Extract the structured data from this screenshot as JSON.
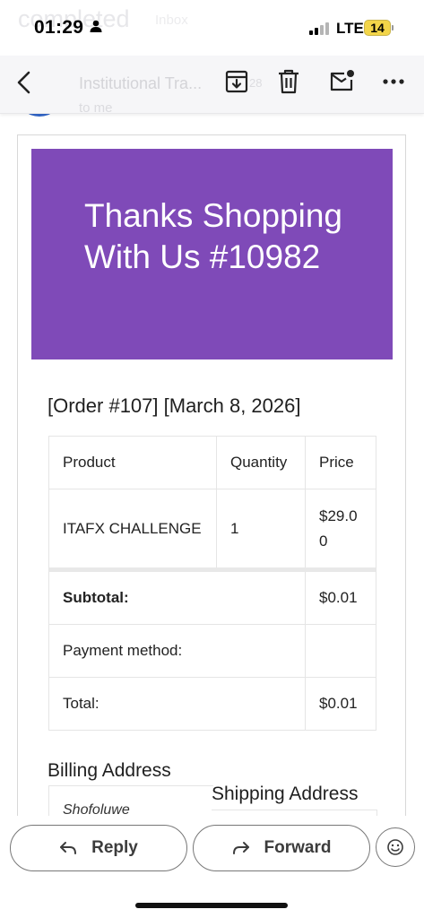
{
  "status_bar": {
    "time": "01:29",
    "network": "LTE",
    "battery": "14",
    "ghost_title": "completed",
    "ghost_inbox": "Inbox"
  },
  "toolbar": {
    "icons": [
      "back-arrow-icon",
      "archive-icon",
      "trash-icon",
      "mark-unread-icon",
      "more-icon"
    ],
    "ghost_sender": "Institutional Tra...",
    "ghost_date": "28",
    "ghost_to_me": "to me"
  },
  "email": {
    "hero_title": "Thanks Shopping With Us #10982",
    "hero_color": "#7f4ab8",
    "order_heading": "[Order #107] [March 8, 2026]",
    "table": {
      "headers": [
        "Product",
        "Quantity",
        "Price"
      ],
      "item": {
        "product": "ITAFX CHALLENGE",
        "quantity": "1",
        "price": "$29.00"
      },
      "subtotal_label": "Subtotal:",
      "subtotal_value": "$0.01",
      "payment_label": "Payment method:",
      "payment_value": "",
      "total_label": "Total:",
      "total_value": "$0.01"
    },
    "billing_heading": "Billing Address",
    "billing_name": "Shofoluwe",
    "shipping_heading": "Shipping Address"
  },
  "actions": {
    "reply_label": "Reply",
    "forward_label": "Forward"
  }
}
